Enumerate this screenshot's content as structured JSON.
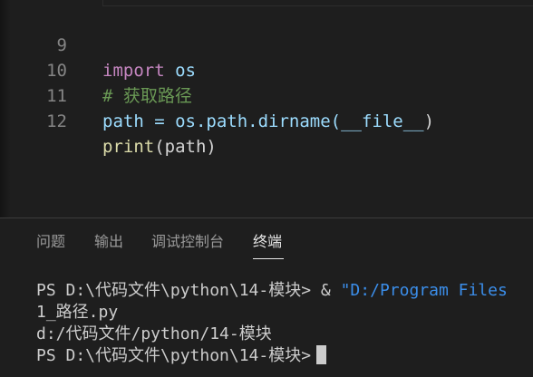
{
  "editor": {
    "lines": [
      {
        "number": "9",
        "keyword": "import",
        "rest": " os"
      },
      {
        "number": "10",
        "comment": "# 获取路径"
      },
      {
        "number": "11",
        "lhs": "path = os.path.dirname(",
        "dunder": "__file__",
        "close": ")"
      },
      {
        "number": "12",
        "fn": "print",
        "args": "(path)"
      }
    ]
  },
  "panel": {
    "tabs": [
      {
        "label": "问题"
      },
      {
        "label": "输出"
      },
      {
        "label": "调试控制台"
      },
      {
        "label": "终端",
        "active": true
      }
    ],
    "terminal": {
      "line1_prompt": "PS D:\\代码文件\\python\\14-模块> ",
      "line1_amp": "& ",
      "line1_str": "\"D:/Program Files",
      "line2": "1_路径.py",
      "line3": "d:/代码文件/python/14-模块",
      "line4_prompt": "PS D:\\代码文件\\python\\14-模块>"
    }
  },
  "colors": {
    "background": "#1e1e1e",
    "keyword": "#c586c0",
    "function": "#dcdcaa",
    "comment": "#6a9955",
    "identifier": "#9cdcfe",
    "string": "#3b8eea",
    "line_number": "#858585"
  }
}
